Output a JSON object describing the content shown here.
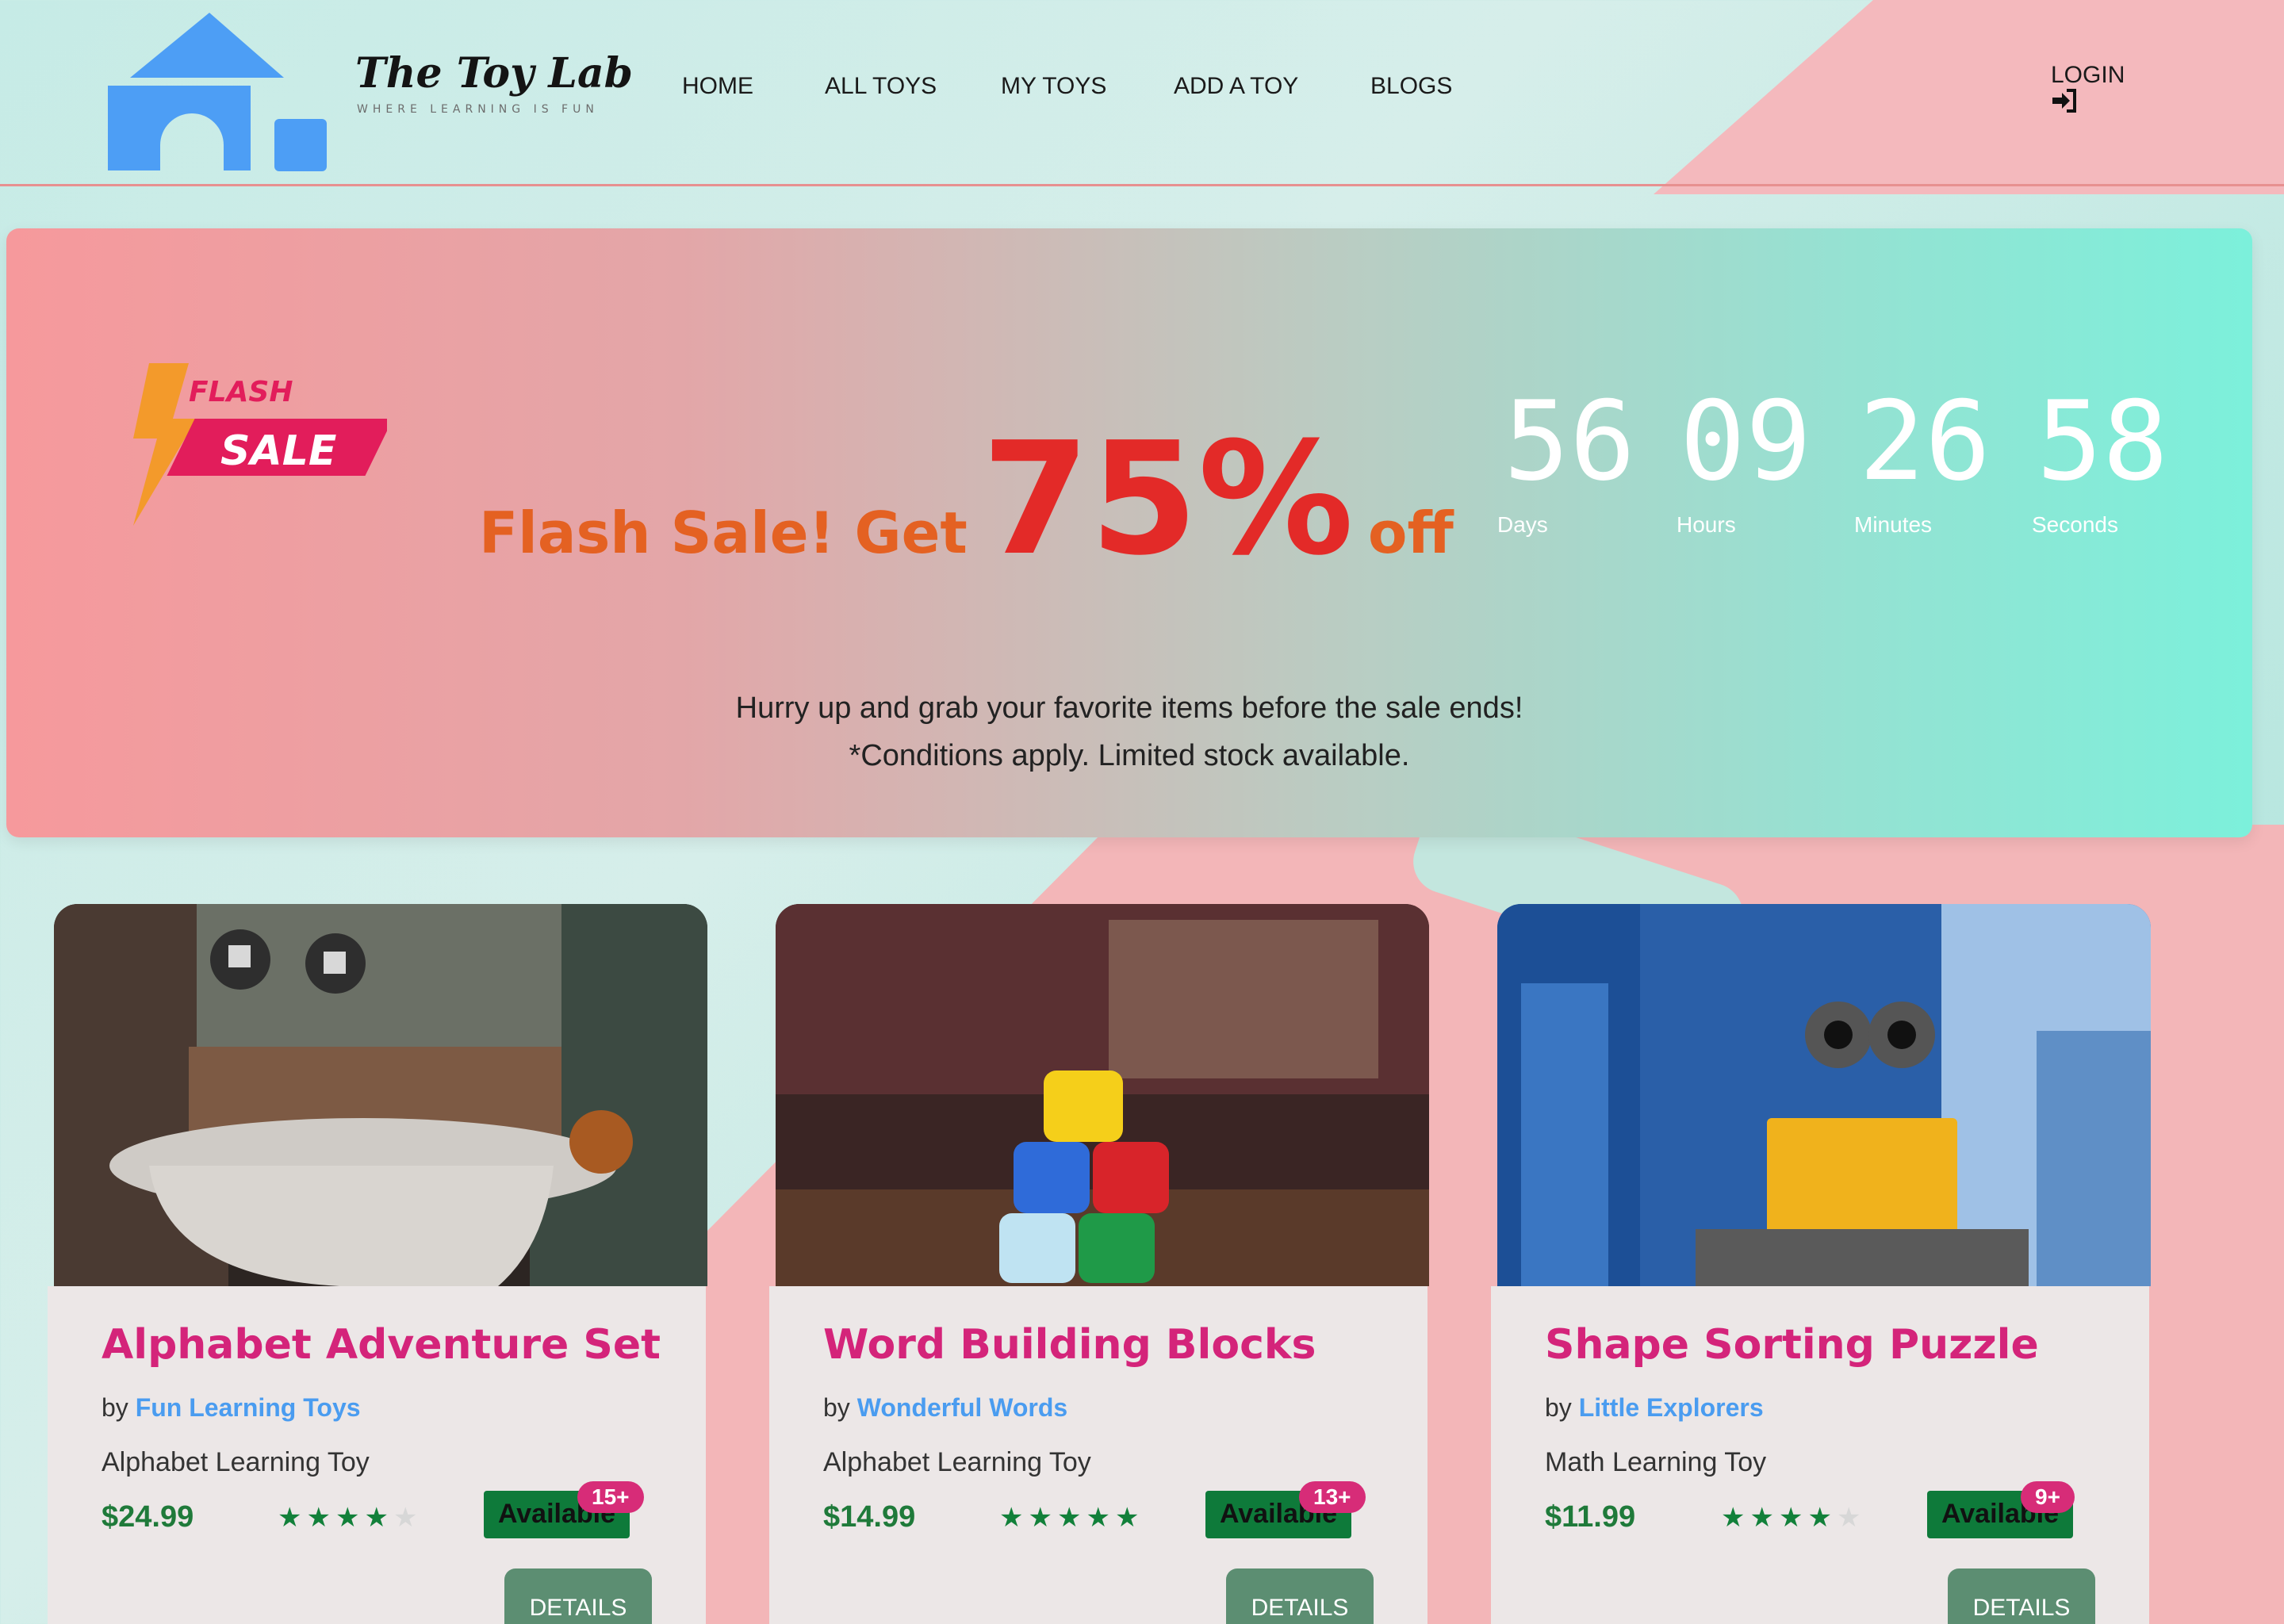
{
  "brand": {
    "name": "The Toy Lab",
    "tagline": "WHERE LEARNING IS FUN"
  },
  "nav": {
    "items": [
      "HOME",
      "ALL TOYS",
      "MY TOYS",
      "ADD A TOY",
      "BLOGS"
    ],
    "login_label": "LOGIN",
    "login_icon": "sign-in-icon"
  },
  "banner": {
    "badge_top": "FLASH",
    "badge_bottom": "SALE",
    "headline_pre": "Flash Sale! Get",
    "headline_percent": "75%",
    "headline_post": "off",
    "countdown": [
      {
        "value": "56",
        "label": "Days"
      },
      {
        "value": "09",
        "label": "Hours"
      },
      {
        "value": "26",
        "label": "Minutes"
      },
      {
        "value": "58",
        "label": "Seconds"
      }
    ],
    "line1": "Hurry up and grab your favorite items before the sale ends!",
    "line2": "*Conditions apply. Limited stock available."
  },
  "products": [
    {
      "title": "Alphabet Adventure Set",
      "by": "by",
      "maker": "Fun Learning Toys",
      "category": "Alphabet Learning Toy",
      "price": "$24.99",
      "rating": 4,
      "status": "Available",
      "age": "15+",
      "details_label": "DETAILS",
      "image": "robot-toy-photo"
    },
    {
      "title": "Word Building Blocks",
      "by": "by",
      "maker": "Wonderful Words",
      "category": "Alphabet Learning Toy",
      "price": "$14.99",
      "rating": 4.5,
      "status": "Available",
      "age": "13+",
      "details_label": "DETAILS",
      "image": "dice-stack-photo"
    },
    {
      "title": "Shape Sorting Puzzle",
      "by": "by",
      "maker": "Little Explorers",
      "category": "Math Learning Toy",
      "price": "$11.99",
      "rating": 4,
      "status": "Available",
      "age": "9+",
      "details_label": "DETAILS",
      "image": "wall-e-toy-photo"
    }
  ],
  "colors": {
    "accent_pink": "#d4247a",
    "maker_blue": "#4a9cf0",
    "price_green": "#1f7a3a",
    "sale_red": "#e32a28",
    "sale_orange": "#e46122"
  }
}
